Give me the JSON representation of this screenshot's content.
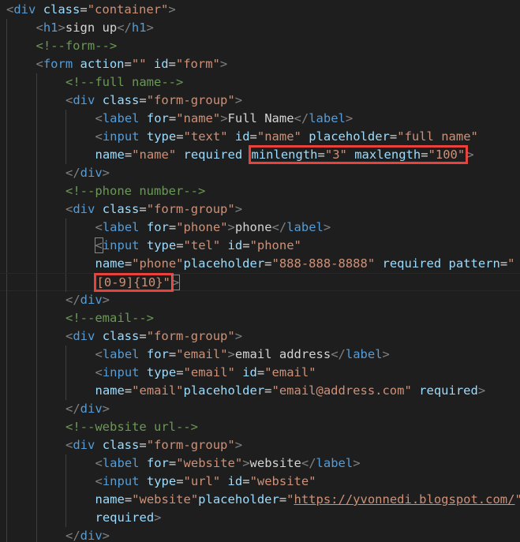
{
  "editor": {
    "colors": {
      "background": "#1e1e1e",
      "tag": "#569cd6",
      "attribute": "#9cdcfe",
      "string": "#ce9178",
      "comment": "#6a9955",
      "text": "#d4d4d4",
      "highlight_box": "#e8423c"
    },
    "lines": [
      {
        "indent": 0,
        "tokens": [
          {
            "t": "<",
            "c": "lt"
          },
          {
            "t": "div",
            "c": "tag"
          },
          {
            "t": " "
          },
          {
            "t": "class",
            "c": "attr"
          },
          {
            "t": "="
          },
          {
            "t": "\"container\"",
            "c": "str"
          },
          {
            "t": ">",
            "c": "lt"
          }
        ]
      },
      {
        "indent": 1,
        "tokens": [
          {
            "t": "<",
            "c": "lt"
          },
          {
            "t": "h1",
            "c": "tag"
          },
          {
            "t": ">",
            "c": "lt"
          },
          {
            "t": "sign up",
            "c": "txt"
          },
          {
            "t": "</",
            "c": "lt"
          },
          {
            "t": "h1",
            "c": "tag"
          },
          {
            "t": ">",
            "c": "lt"
          }
        ]
      },
      {
        "indent": 1,
        "tokens": [
          {
            "t": "<!--form-->",
            "c": "cmt"
          }
        ]
      },
      {
        "indent": 1,
        "tokens": [
          {
            "t": "<",
            "c": "lt"
          },
          {
            "t": "form",
            "c": "tag"
          },
          {
            "t": " "
          },
          {
            "t": "action",
            "c": "attr"
          },
          {
            "t": "="
          },
          {
            "t": "\"\"",
            "c": "str"
          },
          {
            "t": " "
          },
          {
            "t": "id",
            "c": "attr"
          },
          {
            "t": "="
          },
          {
            "t": "\"form\"",
            "c": "str"
          },
          {
            "t": ">",
            "c": "lt"
          }
        ]
      },
      {
        "indent": 2,
        "tokens": [
          {
            "t": "<!--full name-->",
            "c": "cmt"
          }
        ]
      },
      {
        "indent": 2,
        "tokens": [
          {
            "t": "<",
            "c": "lt"
          },
          {
            "t": "div",
            "c": "tag"
          },
          {
            "t": " "
          },
          {
            "t": "class",
            "c": "attr"
          },
          {
            "t": "="
          },
          {
            "t": "\"form-group\"",
            "c": "str"
          },
          {
            "t": ">",
            "c": "lt"
          }
        ]
      },
      {
        "indent": 3,
        "tokens": [
          {
            "t": "<",
            "c": "lt"
          },
          {
            "t": "label",
            "c": "tag"
          },
          {
            "t": " "
          },
          {
            "t": "for",
            "c": "attr"
          },
          {
            "t": "="
          },
          {
            "t": "\"name\"",
            "c": "str"
          },
          {
            "t": ">",
            "c": "lt"
          },
          {
            "t": "Full Name",
            "c": "txt"
          },
          {
            "t": "</",
            "c": "lt"
          },
          {
            "t": "label",
            "c": "tag"
          },
          {
            "t": ">",
            "c": "lt"
          }
        ]
      },
      {
        "indent": 3,
        "tokens": [
          {
            "t": "<",
            "c": "lt"
          },
          {
            "t": "input",
            "c": "tag"
          },
          {
            "t": " "
          },
          {
            "t": "type",
            "c": "attr"
          },
          {
            "t": "="
          },
          {
            "t": "\"text\"",
            "c": "str"
          },
          {
            "t": " "
          },
          {
            "t": "id",
            "c": "attr"
          },
          {
            "t": "="
          },
          {
            "t": "\"name\"",
            "c": "str"
          },
          {
            "t": " "
          },
          {
            "t": "placeholder",
            "c": "attr"
          },
          {
            "t": "="
          },
          {
            "t": "\"full name\"",
            "c": "str"
          }
        ]
      },
      {
        "indent": 3,
        "tokens": [
          {
            "t": "name",
            "c": "attr"
          },
          {
            "t": "="
          },
          {
            "t": "\"name\"",
            "c": "str"
          },
          {
            "t": " "
          },
          {
            "t": "required",
            "c": "attr"
          },
          {
            "t": " "
          },
          {
            "group": "hl",
            "tokens": [
              {
                "t": "minlength",
                "c": "attr"
              },
              {
                "t": "="
              },
              {
                "t": "\"3\"",
                "c": "str"
              },
              {
                "t": " "
              },
              {
                "t": "maxlength",
                "c": "attr"
              },
              {
                "t": "="
              },
              {
                "t": "\"100\"",
                "c": "str"
              }
            ]
          },
          {
            "t": ">",
            "c": "lt"
          }
        ]
      },
      {
        "indent": 2,
        "tokens": [
          {
            "t": "</",
            "c": "lt"
          },
          {
            "t": "div",
            "c": "tag"
          },
          {
            "t": ">",
            "c": "lt"
          }
        ]
      },
      {
        "indent": 2,
        "tokens": [
          {
            "t": "<!--phone number-->",
            "c": "cmt"
          }
        ]
      },
      {
        "indent": 2,
        "tokens": [
          {
            "t": "<",
            "c": "lt"
          },
          {
            "t": "div",
            "c": "tag"
          },
          {
            "t": " "
          },
          {
            "t": "class",
            "c": "attr"
          },
          {
            "t": "="
          },
          {
            "t": "\"form-group\"",
            "c": "str"
          },
          {
            "t": ">",
            "c": "lt"
          }
        ]
      },
      {
        "indent": 3,
        "tokens": [
          {
            "t": "<",
            "c": "lt"
          },
          {
            "t": "label",
            "c": "tag"
          },
          {
            "t": " "
          },
          {
            "t": "for",
            "c": "attr"
          },
          {
            "t": "="
          },
          {
            "t": "\"phone\"",
            "c": "str"
          },
          {
            "t": ">",
            "c": "lt"
          },
          {
            "t": "phone",
            "c": "txt"
          },
          {
            "t": "</",
            "c": "lt"
          },
          {
            "t": "label",
            "c": "tag"
          },
          {
            "t": ">",
            "c": "lt"
          }
        ]
      },
      {
        "indent": 3,
        "tokens": [
          {
            "t": "<",
            "c": "lt bracket-match"
          },
          {
            "t": "input",
            "c": "tag"
          },
          {
            "t": " "
          },
          {
            "t": "type",
            "c": "attr"
          },
          {
            "t": "="
          },
          {
            "t": "\"tel\"",
            "c": "str"
          },
          {
            "t": " "
          },
          {
            "t": "id",
            "c": "attr"
          },
          {
            "t": "="
          },
          {
            "t": "\"phone\"",
            "c": "str"
          }
        ]
      },
      {
        "indent": 3,
        "tokens": [
          {
            "t": "name",
            "c": "attr"
          },
          {
            "t": "="
          },
          {
            "t": "\"phone\"",
            "c": "str"
          },
          {
            "t": "placeholder",
            "c": "attr"
          },
          {
            "t": "="
          },
          {
            "t": "\"888-888-8888\"",
            "c": "str"
          },
          {
            "t": " "
          },
          {
            "t": "required",
            "c": "attr"
          },
          {
            "t": " "
          },
          {
            "t": "pattern",
            "c": "attr"
          },
          {
            "t": "="
          },
          {
            "t": "\"",
            "c": "str"
          }
        ]
      },
      {
        "indent": 3,
        "cursor": true,
        "tokens": [
          {
            "group": "hl",
            "tokens": [
              {
                "t": "[0-9]{10}\"",
                "c": "str"
              }
            ]
          },
          {
            "t": ">",
            "c": "lt bracket-match"
          }
        ]
      },
      {
        "indent": 2,
        "tokens": [
          {
            "t": "</",
            "c": "lt"
          },
          {
            "t": "div",
            "c": "tag"
          },
          {
            "t": ">",
            "c": "lt"
          }
        ]
      },
      {
        "indent": 2,
        "tokens": [
          {
            "t": "<!--email-->",
            "c": "cmt"
          }
        ]
      },
      {
        "indent": 2,
        "tokens": [
          {
            "t": "<",
            "c": "lt"
          },
          {
            "t": "div",
            "c": "tag"
          },
          {
            "t": " "
          },
          {
            "t": "class",
            "c": "attr"
          },
          {
            "t": "="
          },
          {
            "t": "\"form-group\"",
            "c": "str"
          },
          {
            "t": ">",
            "c": "lt"
          }
        ]
      },
      {
        "indent": 3,
        "tokens": [
          {
            "t": "<",
            "c": "lt"
          },
          {
            "t": "label",
            "c": "tag"
          },
          {
            "t": " "
          },
          {
            "t": "for",
            "c": "attr"
          },
          {
            "t": "="
          },
          {
            "t": "\"email\"",
            "c": "str"
          },
          {
            "t": ">",
            "c": "lt"
          },
          {
            "t": "email address",
            "c": "txt"
          },
          {
            "t": "</",
            "c": "lt"
          },
          {
            "t": "label",
            "c": "tag"
          },
          {
            "t": ">",
            "c": "lt"
          }
        ]
      },
      {
        "indent": 3,
        "tokens": [
          {
            "t": "<",
            "c": "lt"
          },
          {
            "t": "input",
            "c": "tag"
          },
          {
            "t": " "
          },
          {
            "t": "type",
            "c": "attr"
          },
          {
            "t": "="
          },
          {
            "t": "\"email\"",
            "c": "str"
          },
          {
            "t": " "
          },
          {
            "t": "id",
            "c": "attr"
          },
          {
            "t": "="
          },
          {
            "t": "\"email\"",
            "c": "str"
          }
        ]
      },
      {
        "indent": 3,
        "tokens": [
          {
            "t": "name",
            "c": "attr"
          },
          {
            "t": "="
          },
          {
            "t": "\"email\"",
            "c": "str"
          },
          {
            "t": "placeholder",
            "c": "attr"
          },
          {
            "t": "="
          },
          {
            "t": "\"email@address.com\"",
            "c": "str"
          },
          {
            "t": " "
          },
          {
            "t": "required",
            "c": "attr"
          },
          {
            "t": ">",
            "c": "lt"
          }
        ]
      },
      {
        "indent": 2,
        "tokens": [
          {
            "t": "</",
            "c": "lt"
          },
          {
            "t": "div",
            "c": "tag"
          },
          {
            "t": ">",
            "c": "lt"
          }
        ]
      },
      {
        "indent": 2,
        "tokens": [
          {
            "t": "<!--website url-->",
            "c": "cmt"
          }
        ]
      },
      {
        "indent": 2,
        "tokens": [
          {
            "t": "<",
            "c": "lt"
          },
          {
            "t": "div",
            "c": "tag"
          },
          {
            "t": " "
          },
          {
            "t": "class",
            "c": "attr"
          },
          {
            "t": "="
          },
          {
            "t": "\"form-group\"",
            "c": "str"
          },
          {
            "t": ">",
            "c": "lt"
          }
        ]
      },
      {
        "indent": 3,
        "tokens": [
          {
            "t": "<",
            "c": "lt"
          },
          {
            "t": "label",
            "c": "tag"
          },
          {
            "t": " "
          },
          {
            "t": "for",
            "c": "attr"
          },
          {
            "t": "="
          },
          {
            "t": "\"website\"",
            "c": "str"
          },
          {
            "t": ">",
            "c": "lt"
          },
          {
            "t": "website",
            "c": "txt"
          },
          {
            "t": "</",
            "c": "lt"
          },
          {
            "t": "label",
            "c": "tag"
          },
          {
            "t": ">",
            "c": "lt"
          }
        ]
      },
      {
        "indent": 3,
        "tokens": [
          {
            "t": "<",
            "c": "lt"
          },
          {
            "t": "input",
            "c": "tag"
          },
          {
            "t": " "
          },
          {
            "t": "type",
            "c": "attr"
          },
          {
            "t": "="
          },
          {
            "t": "\"url\"",
            "c": "str"
          },
          {
            "t": " "
          },
          {
            "t": "id",
            "c": "attr"
          },
          {
            "t": "="
          },
          {
            "t": "\"website\"",
            "c": "str"
          }
        ]
      },
      {
        "indent": 3,
        "tokens": [
          {
            "t": "name",
            "c": "attr"
          },
          {
            "t": "="
          },
          {
            "t": "\"website\"",
            "c": "str"
          },
          {
            "t": "placeholder",
            "c": "attr"
          },
          {
            "t": "="
          },
          {
            "t": "\"",
            "c": "str"
          },
          {
            "t": "https://yvonnedi.blogspot.com/",
            "c": "str url"
          },
          {
            "t": "\"",
            "c": "str"
          }
        ]
      },
      {
        "indent": 3,
        "tokens": [
          {
            "t": "required",
            "c": "attr"
          },
          {
            "t": ">",
            "c": "lt"
          }
        ]
      },
      {
        "indent": 2,
        "tokens": [
          {
            "t": "</",
            "c": "lt"
          },
          {
            "t": "div",
            "c": "tag"
          },
          {
            "t": ">",
            "c": "lt"
          }
        ]
      }
    ]
  }
}
